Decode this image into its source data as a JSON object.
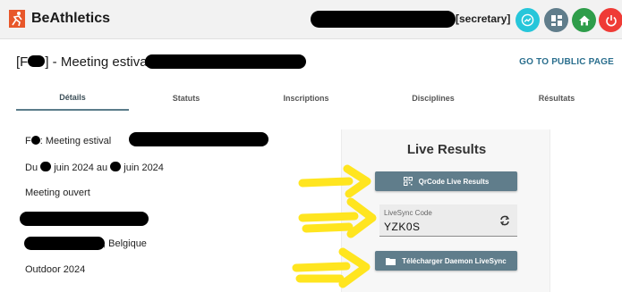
{
  "appbar": {
    "brand": "BeAthletics",
    "role": "[secretary]",
    "colors": {
      "chart": "#26c6da",
      "dashboard": "#607d8b",
      "home": "#2e9d4a",
      "power": "#ef3b36"
    },
    "icons": [
      "chart-icon",
      "dashboard-icon",
      "home-icon",
      "power-icon"
    ]
  },
  "header": {
    "title_prefix": "[F",
    "title_mid": "] - Meeting estival",
    "public_link": "GO TO PUBLIC PAGE"
  },
  "tabs": [
    {
      "label": "Détails"
    },
    {
      "label": "Statuts"
    },
    {
      "label": "Inscriptions"
    },
    {
      "label": "Disciplines"
    },
    {
      "label": "Résultats"
    }
  ],
  "details": {
    "line1_prefix": "F",
    "line1_text": ": Meeting estival",
    "line2_a": "Du",
    "line2_b": "juin 2024 au",
    "line2_c": "juin 2024",
    "status": "Meeting ouvert",
    "country": ", Belgique",
    "season": "Outdoor 2024"
  },
  "live": {
    "title": "Live Results",
    "qr_button": "QrCode Live Results",
    "code_label": "LiveSync Code",
    "code_value": "YZK0S",
    "download_button": "Télécharger Daemon LiveSync"
  }
}
